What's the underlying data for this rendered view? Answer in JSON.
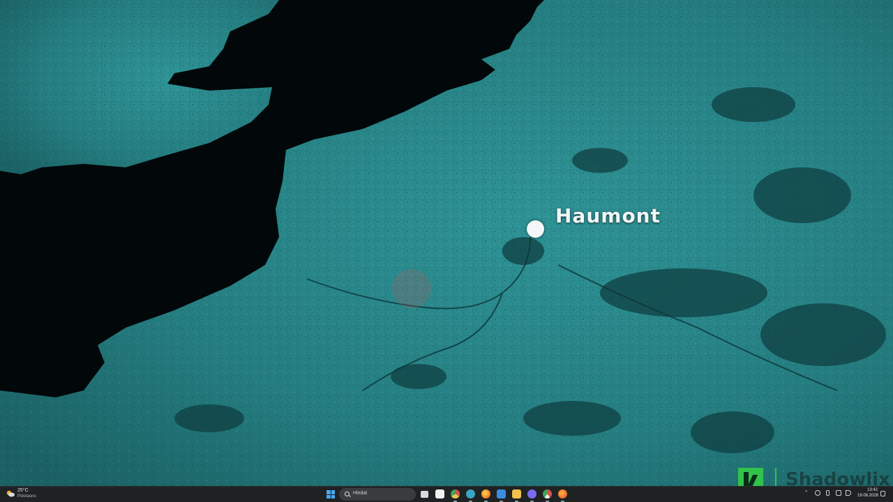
{
  "map": {
    "location_label": "Haumont"
  },
  "watermark": {
    "brand": "Shadowlix"
  },
  "taskbar": {
    "weather": {
      "temperature": "25°C",
      "condition": "Poloíasno"
    },
    "search": {
      "label": "Hledat"
    },
    "apps": [
      {
        "name": "task-view-icon",
        "color": "#d9d9d9"
      },
      {
        "name": "store-icon",
        "color": "#f0f0f0"
      },
      {
        "name": "chrome-icon",
        "color": "#e8c84a"
      },
      {
        "name": "edge-icon",
        "color": "#3aa6c4"
      },
      {
        "name": "firefox-icon",
        "color": "#f08a2a"
      },
      {
        "name": "mail-icon",
        "color": "#3b8de0"
      },
      {
        "name": "file-explorer-icon",
        "color": "#f2c14e"
      },
      {
        "name": "messenger-icon",
        "color": "#7a6cf0"
      },
      {
        "name": "chrome-dev-icon",
        "color": "#d9534f"
      },
      {
        "name": "firefox-alt-icon",
        "color": "#f0762a"
      }
    ],
    "clock": {
      "time": "13:42",
      "date": "19.08.2026"
    }
  },
  "colors": {
    "land": "#2a8a8c",
    "sea": "#020809",
    "taskbar": "#1f2223",
    "marker": "#f4f7f7",
    "watermark_logo": "#31c34a"
  }
}
